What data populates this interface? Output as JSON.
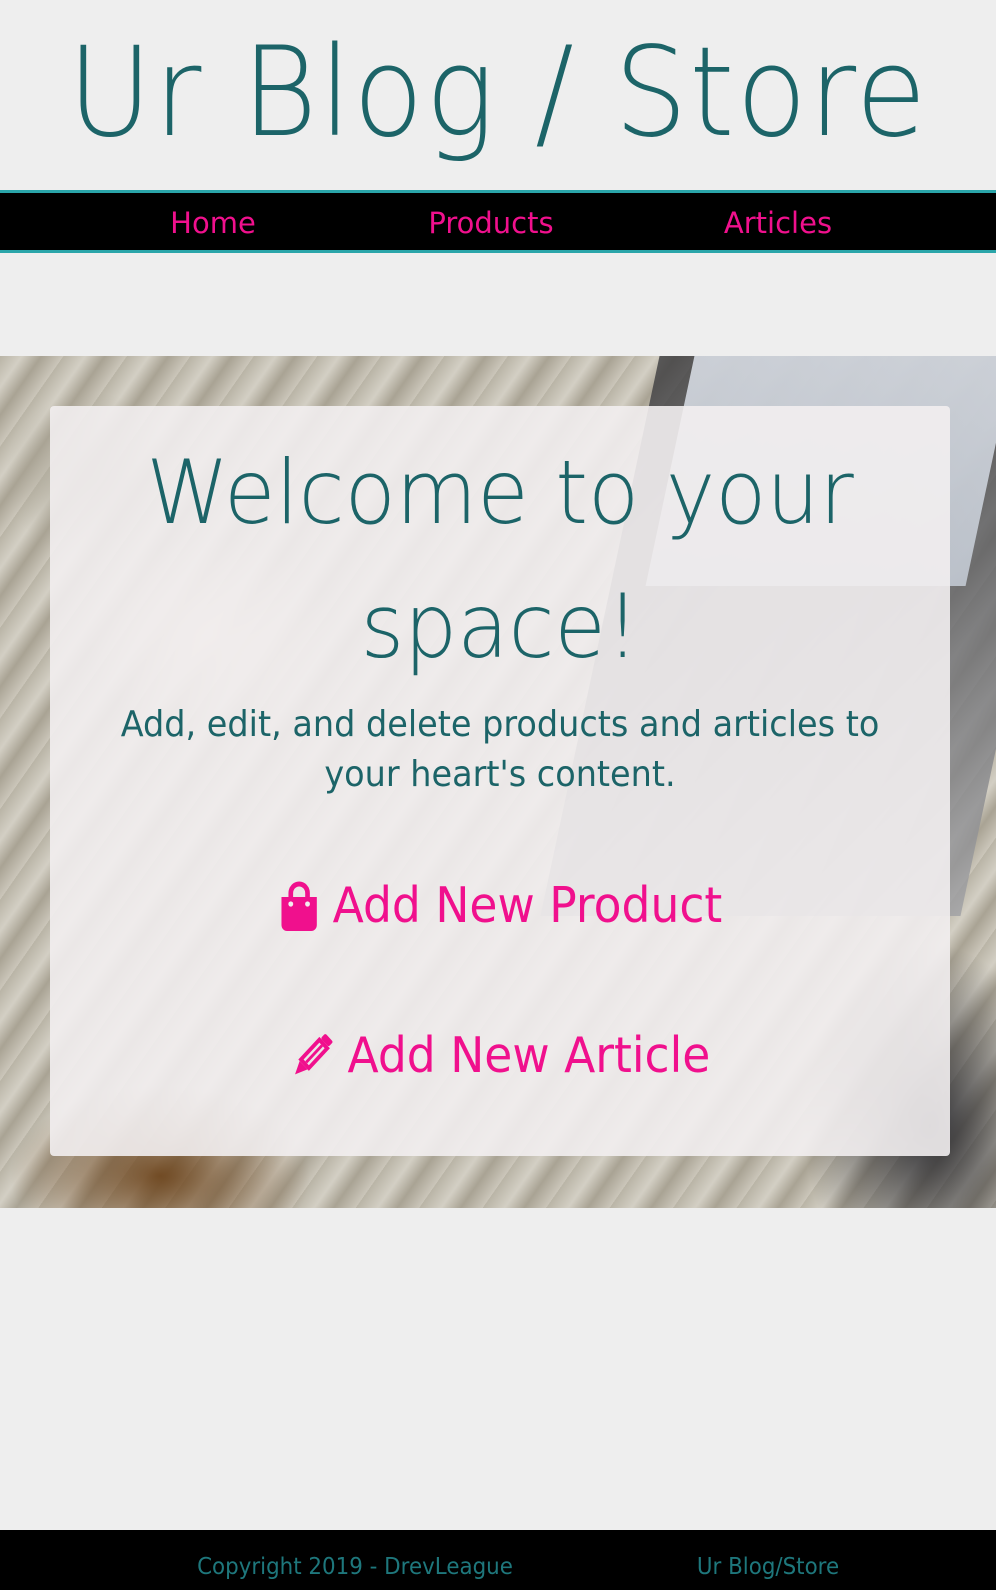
{
  "site": {
    "title": "Ur Blog / Store"
  },
  "nav": {
    "home": "Home",
    "products": "Products",
    "articles": "Articles"
  },
  "hero": {
    "heading": "Welcome to your space!",
    "description": "Add, edit, and delete products and articles to your heart's content.",
    "add_product_label": "Add New Product",
    "add_product_icon": "shopping-bag-icon",
    "add_article_label": "Add New Article",
    "add_article_icon": "pencil-icon"
  },
  "footer": {
    "copyright": "Copyright 2019 - DrevLeague",
    "brand": "Ur Blog/Store"
  },
  "colors": {
    "primary_teal": "#1c6468",
    "accent_pink": "#f0108d",
    "nav_background": "#000000",
    "nav_border": "#2aa5a9",
    "page_background": "#eeeeee"
  }
}
